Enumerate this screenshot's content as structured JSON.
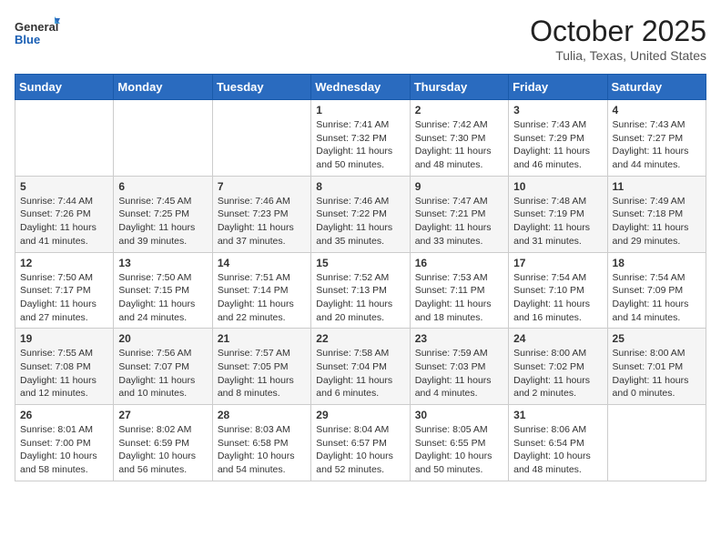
{
  "logo": {
    "line1": "General",
    "line2": "Blue"
  },
  "header": {
    "month": "October 2025",
    "location": "Tulia, Texas, United States"
  },
  "weekdays": [
    "Sunday",
    "Monday",
    "Tuesday",
    "Wednesday",
    "Thursday",
    "Friday",
    "Saturday"
  ],
  "weeks": [
    [
      {
        "day": "",
        "info": ""
      },
      {
        "day": "",
        "info": ""
      },
      {
        "day": "",
        "info": ""
      },
      {
        "day": "1",
        "info": "Sunrise: 7:41 AM\nSunset: 7:32 PM\nDaylight: 11 hours and 50 minutes."
      },
      {
        "day": "2",
        "info": "Sunrise: 7:42 AM\nSunset: 7:30 PM\nDaylight: 11 hours and 48 minutes."
      },
      {
        "day": "3",
        "info": "Sunrise: 7:43 AM\nSunset: 7:29 PM\nDaylight: 11 hours and 46 minutes."
      },
      {
        "day": "4",
        "info": "Sunrise: 7:43 AM\nSunset: 7:27 PM\nDaylight: 11 hours and 44 minutes."
      }
    ],
    [
      {
        "day": "5",
        "info": "Sunrise: 7:44 AM\nSunset: 7:26 PM\nDaylight: 11 hours and 41 minutes."
      },
      {
        "day": "6",
        "info": "Sunrise: 7:45 AM\nSunset: 7:25 PM\nDaylight: 11 hours and 39 minutes."
      },
      {
        "day": "7",
        "info": "Sunrise: 7:46 AM\nSunset: 7:23 PM\nDaylight: 11 hours and 37 minutes."
      },
      {
        "day": "8",
        "info": "Sunrise: 7:46 AM\nSunset: 7:22 PM\nDaylight: 11 hours and 35 minutes."
      },
      {
        "day": "9",
        "info": "Sunrise: 7:47 AM\nSunset: 7:21 PM\nDaylight: 11 hours and 33 minutes."
      },
      {
        "day": "10",
        "info": "Sunrise: 7:48 AM\nSunset: 7:19 PM\nDaylight: 11 hours and 31 minutes."
      },
      {
        "day": "11",
        "info": "Sunrise: 7:49 AM\nSunset: 7:18 PM\nDaylight: 11 hours and 29 minutes."
      }
    ],
    [
      {
        "day": "12",
        "info": "Sunrise: 7:50 AM\nSunset: 7:17 PM\nDaylight: 11 hours and 27 minutes."
      },
      {
        "day": "13",
        "info": "Sunrise: 7:50 AM\nSunset: 7:15 PM\nDaylight: 11 hours and 24 minutes."
      },
      {
        "day": "14",
        "info": "Sunrise: 7:51 AM\nSunset: 7:14 PM\nDaylight: 11 hours and 22 minutes."
      },
      {
        "day": "15",
        "info": "Sunrise: 7:52 AM\nSunset: 7:13 PM\nDaylight: 11 hours and 20 minutes."
      },
      {
        "day": "16",
        "info": "Sunrise: 7:53 AM\nSunset: 7:11 PM\nDaylight: 11 hours and 18 minutes."
      },
      {
        "day": "17",
        "info": "Sunrise: 7:54 AM\nSunset: 7:10 PM\nDaylight: 11 hours and 16 minutes."
      },
      {
        "day": "18",
        "info": "Sunrise: 7:54 AM\nSunset: 7:09 PM\nDaylight: 11 hours and 14 minutes."
      }
    ],
    [
      {
        "day": "19",
        "info": "Sunrise: 7:55 AM\nSunset: 7:08 PM\nDaylight: 11 hours and 12 minutes."
      },
      {
        "day": "20",
        "info": "Sunrise: 7:56 AM\nSunset: 7:07 PM\nDaylight: 11 hours and 10 minutes."
      },
      {
        "day": "21",
        "info": "Sunrise: 7:57 AM\nSunset: 7:05 PM\nDaylight: 11 hours and 8 minutes."
      },
      {
        "day": "22",
        "info": "Sunrise: 7:58 AM\nSunset: 7:04 PM\nDaylight: 11 hours and 6 minutes."
      },
      {
        "day": "23",
        "info": "Sunrise: 7:59 AM\nSunset: 7:03 PM\nDaylight: 11 hours and 4 minutes."
      },
      {
        "day": "24",
        "info": "Sunrise: 8:00 AM\nSunset: 7:02 PM\nDaylight: 11 hours and 2 minutes."
      },
      {
        "day": "25",
        "info": "Sunrise: 8:00 AM\nSunset: 7:01 PM\nDaylight: 11 hours and 0 minutes."
      }
    ],
    [
      {
        "day": "26",
        "info": "Sunrise: 8:01 AM\nSunset: 7:00 PM\nDaylight: 10 hours and 58 minutes."
      },
      {
        "day": "27",
        "info": "Sunrise: 8:02 AM\nSunset: 6:59 PM\nDaylight: 10 hours and 56 minutes."
      },
      {
        "day": "28",
        "info": "Sunrise: 8:03 AM\nSunset: 6:58 PM\nDaylight: 10 hours and 54 minutes."
      },
      {
        "day": "29",
        "info": "Sunrise: 8:04 AM\nSunset: 6:57 PM\nDaylight: 10 hours and 52 minutes."
      },
      {
        "day": "30",
        "info": "Sunrise: 8:05 AM\nSunset: 6:55 PM\nDaylight: 10 hours and 50 minutes."
      },
      {
        "day": "31",
        "info": "Sunrise: 8:06 AM\nSunset: 6:54 PM\nDaylight: 10 hours and 48 minutes."
      },
      {
        "day": "",
        "info": ""
      }
    ]
  ]
}
